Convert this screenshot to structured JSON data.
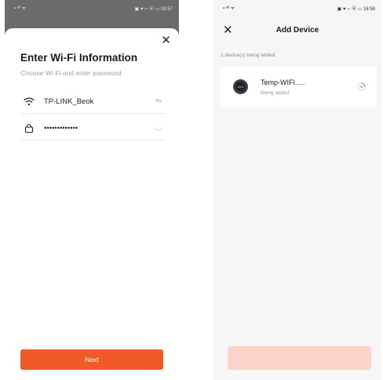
{
  "left": {
    "status_bar": {
      "left": "▪ ᵃˡˡ ᯤ",
      "right": "▣ ♥ ▫▫ ⦿ ▭ 16:57"
    },
    "title": "Enter Wi-Fi Information",
    "subtitle": "Choose Wi-Fi and enter password",
    "ssid": {
      "value": "TP-LINK_Beok",
      "icon": "wifi-icon",
      "action_icon": "switch-network-icon"
    },
    "password": {
      "value": "•••••••••••••",
      "icon": "lock-icon",
      "action_icon": "show-password-icon"
    },
    "next_label": "Next",
    "accent": "#f05a28"
  },
  "right": {
    "status_bar": {
      "left": "▪ ᵃˡˡ ᯤ",
      "right": "▣ ♥ ▫▫ ⦿ ▭ 16:58"
    },
    "title": "Add Device",
    "count_text": "1 device(s) being added",
    "device": {
      "name": "Temp-WIFI.....",
      "status": "Being added",
      "display": "20.5",
      "icon": "thermostat-icon"
    },
    "done_color": "#fad4c8"
  }
}
